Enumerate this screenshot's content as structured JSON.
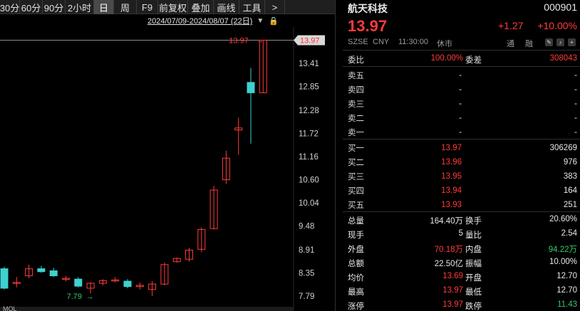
{
  "toolbar": {
    "tabs": [
      "30分",
      "60分",
      "90分",
      "2小时",
      "日",
      "周",
      "F9",
      "前复权",
      "叠加",
      "画线",
      "工具",
      ">"
    ],
    "active": "日"
  },
  "chart_header": {
    "date_range": "2024/07/09-2024/08/07 (22日)",
    "caret": "▼",
    "lock": "🔒"
  },
  "chart_data": {
    "type": "candlestick",
    "y_ticks": [
      "13.41",
      "12.85",
      "12.28",
      "11.72",
      "11.16",
      "10.60",
      "10.04",
      "9.48",
      "8.91",
      "8.35",
      "7.79"
    ],
    "y_range": [
      7.55,
      14.15
    ],
    "last_price": "13.97",
    "high_label": "13.97",
    "low_label": "7.79",
    "bottom_label": "MOL",
    "candles": [
      {
        "o": 8.45,
        "h": 8.5,
        "l": 7.95,
        "c": 7.98
      },
      {
        "o": 8.1,
        "h": 8.25,
        "l": 8.0,
        "c": 8.12
      },
      {
        "o": 8.28,
        "h": 8.55,
        "l": 8.22,
        "c": 8.45
      },
      {
        "o": 8.45,
        "h": 8.52,
        "l": 8.35,
        "c": 8.38
      },
      {
        "o": 8.4,
        "h": 8.47,
        "l": 8.25,
        "c": 8.28
      },
      {
        "o": 8.2,
        "h": 8.27,
        "l": 8.15,
        "c": 8.22
      },
      {
        "o": 8.2,
        "h": 8.25,
        "l": 8.0,
        "c": 8.03
      },
      {
        "o": 7.98,
        "h": 8.12,
        "l": 7.85,
        "c": 8.1
      },
      {
        "o": 8.1,
        "h": 8.2,
        "l": 8.05,
        "c": 8.16
      },
      {
        "o": 8.16,
        "h": 8.25,
        "l": 8.12,
        "c": 8.18
      },
      {
        "o": 8.15,
        "h": 8.2,
        "l": 7.98,
        "c": 8.02
      },
      {
        "o": 8.02,
        "h": 8.12,
        "l": 7.95,
        "c": 8.05
      },
      {
        "o": 7.95,
        "h": 8.15,
        "l": 7.79,
        "c": 8.08
      },
      {
        "o": 8.08,
        "h": 8.6,
        "l": 8.05,
        "c": 8.55
      },
      {
        "o": 8.62,
        "h": 8.72,
        "l": 8.6,
        "c": 8.7
      },
      {
        "o": 8.68,
        "h": 8.95,
        "l": 8.62,
        "c": 8.9
      },
      {
        "o": 8.92,
        "h": 9.45,
        "l": 8.85,
        "c": 9.4
      },
      {
        "o": 9.42,
        "h": 10.45,
        "l": 9.4,
        "c": 10.35
      },
      {
        "o": 10.6,
        "h": 11.3,
        "l": 10.5,
        "c": 11.12
      },
      {
        "o": 11.8,
        "h": 12.1,
        "l": 11.2,
        "c": 11.85
      },
      {
        "o": 12.95,
        "h": 13.3,
        "l": 11.47,
        "c": 12.7
      },
      {
        "o": 12.7,
        "h": 13.97,
        "l": 12.7,
        "c": 13.97
      }
    ]
  },
  "quote": {
    "name": "航天科技",
    "code": "000901",
    "price": "13.97",
    "change": "+1.27",
    "change_pct": "+10.00%",
    "exchange": "SZSE",
    "currency": "CNY",
    "time": "11:30:00",
    "status": "休市",
    "btn_tong": "通",
    "btn_rong": "融",
    "weibi_label": "委比",
    "weibi": "100.00%",
    "weicha_label": "委差",
    "weicha": "308043",
    "asks": [
      {
        "label": "卖五",
        "price": "-",
        "vol": "-"
      },
      {
        "label": "卖四",
        "price": "-",
        "vol": "-"
      },
      {
        "label": "卖三",
        "price": "-",
        "vol": "-"
      },
      {
        "label": "卖二",
        "price": "-",
        "vol": "-"
      },
      {
        "label": "卖一",
        "price": "-",
        "vol": "-"
      }
    ],
    "bids": [
      {
        "label": "买一",
        "price": "13.97",
        "vol": "306269"
      },
      {
        "label": "买二",
        "price": "13.96",
        "vol": "976"
      },
      {
        "label": "买三",
        "price": "13.95",
        "vol": "383"
      },
      {
        "label": "买四",
        "price": "13.94",
        "vol": "164"
      },
      {
        "label": "买五",
        "price": "13.93",
        "vol": "251"
      }
    ],
    "stats": [
      {
        "l1": "总量",
        "v1": "164.40万",
        "c1": "white",
        "l2": "换手",
        "v2": "20.60%",
        "c2": "white"
      },
      {
        "l1": "现手",
        "v1": "5",
        "c1": "white",
        "l2": "量比",
        "v2": "2.54",
        "c2": "white"
      },
      {
        "l1": "外盘",
        "v1": "70.18万",
        "c1": "red",
        "l2": "内盘",
        "v2": "94.22万",
        "c2": "green"
      },
      {
        "l1": "总额",
        "v1": "22.50亿",
        "c1": "white",
        "l2": "振幅",
        "v2": "10.00%",
        "c2": "white"
      },
      {
        "l1": "均价",
        "v1": "13.69",
        "c1": "red",
        "l2": "开盘",
        "v2": "12.70",
        "c2": "white"
      },
      {
        "l1": "最高",
        "v1": "13.97",
        "c1": "red",
        "l2": "最低",
        "v2": "12.70",
        "c2": "white"
      },
      {
        "l1": "涨停",
        "v1": "13.97",
        "c1": "red",
        "l2": "跌停",
        "v2": "11.43",
        "c2": "green"
      }
    ]
  }
}
